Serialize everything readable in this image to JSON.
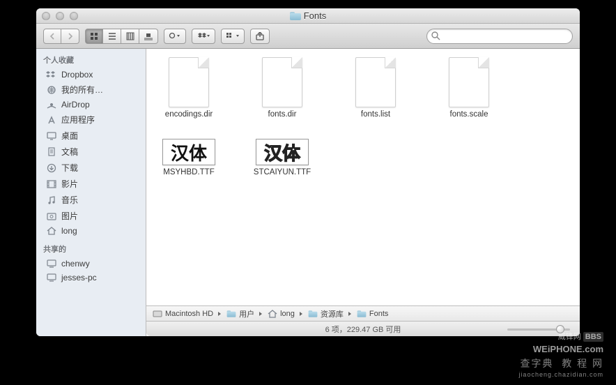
{
  "window": {
    "title": "Fonts"
  },
  "toolbar": {
    "search_placeholder": ""
  },
  "sidebar": {
    "sections": [
      {
        "header": "个人收藏",
        "items": [
          {
            "icon": "dropbox",
            "label": "Dropbox"
          },
          {
            "icon": "network",
            "label": "我的所有…"
          },
          {
            "icon": "airdrop",
            "label": "AirDrop"
          },
          {
            "icon": "apps",
            "label": "应用程序"
          },
          {
            "icon": "desktop",
            "label": "桌面"
          },
          {
            "icon": "docs",
            "label": "文稿"
          },
          {
            "icon": "download",
            "label": "下载"
          },
          {
            "icon": "movies",
            "label": "影片"
          },
          {
            "icon": "music",
            "label": "音乐"
          },
          {
            "icon": "pictures",
            "label": "图片"
          },
          {
            "icon": "home",
            "label": "long"
          }
        ]
      },
      {
        "header": "共享的",
        "items": [
          {
            "icon": "pc",
            "label": "chenwy"
          },
          {
            "icon": "pc",
            "label": "jesses-pc"
          }
        ]
      }
    ]
  },
  "files": [
    {
      "type": "doc",
      "name": "encodings.dir"
    },
    {
      "type": "doc",
      "name": "fonts.dir"
    },
    {
      "type": "doc",
      "name": "fonts.list"
    },
    {
      "type": "doc",
      "name": "fonts.scale"
    },
    {
      "type": "font-solid",
      "name": "MSYHBD.TTF",
      "sample": "汉体"
    },
    {
      "type": "font-outline",
      "name": "STCAIYUN.TTF",
      "sample": "汉体"
    }
  ],
  "path": [
    {
      "icon": "hd",
      "label": "Macintosh HD"
    },
    {
      "icon": "folder",
      "label": "用户"
    },
    {
      "icon": "home",
      "label": "long"
    },
    {
      "icon": "folder",
      "label": "资源库"
    },
    {
      "icon": "folder",
      "label": "Fonts"
    }
  ],
  "status": "6 项，229.47 GB 可用",
  "watermark": {
    "line1": "威锋网",
    "line1b": "WEiPHONE.com",
    "line2": "查字典",
    "line2b": "教 程 网",
    "line2c": "jiaocheng.chazidian.com"
  }
}
